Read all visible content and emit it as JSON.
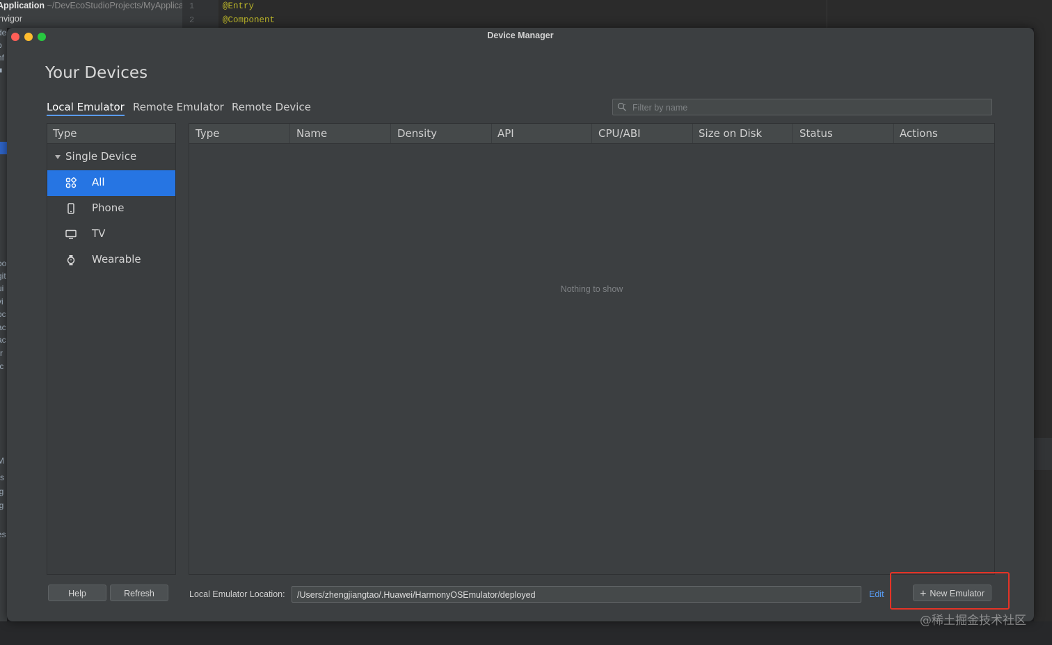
{
  "ide": {
    "project_name": "Application",
    "project_path": "~/DevEcoStudioProjects/MyApplicat",
    "tree_item": "hvigor",
    "line_numbers": [
      "1",
      "2"
    ],
    "code_lines": [
      "@Entry",
      "@Component"
    ],
    "left_strip_glyphs": [
      "de",
      "p",
      "nf",
      "■",
      "oo",
      "git",
      "ui",
      "vi",
      "oc",
      "ac",
      "ac",
      "rr",
      "tc",
      "M",
      "rs",
      "ig",
      "ig",
      "es"
    ]
  },
  "window": {
    "title": "Device Manager"
  },
  "page": {
    "title": "Your Devices"
  },
  "tabs": [
    "Local Emulator",
    "Remote Emulator",
    "Remote Device"
  ],
  "filter": {
    "placeholder": "Filter by name"
  },
  "type_panel": {
    "header": "Type",
    "group": "Single Device",
    "items": [
      {
        "label": "All",
        "icon": "grid-icon",
        "selected": true
      },
      {
        "label": "Phone",
        "icon": "phone-icon",
        "selected": false
      },
      {
        "label": "TV",
        "icon": "tv-icon",
        "selected": false
      },
      {
        "label": "Wearable",
        "icon": "watch-icon",
        "selected": false
      }
    ]
  },
  "table": {
    "columns": [
      "Type",
      "Name",
      "Density",
      "API",
      "CPU/ABI",
      "Size on Disk",
      "Status",
      "Actions"
    ],
    "empty_message": "Nothing to show"
  },
  "footer": {
    "help_label": "Help",
    "refresh_label": "Refresh",
    "location_label": "Local Emulator Location:",
    "location_value": "/Users/zhengjiangtao/.Huawei/HarmonyOSEmulator/deployed",
    "edit_label": "Edit",
    "new_emulator_label": "New Emulator"
  },
  "watermark": "@稀土掘金技术社区",
  "colors": {
    "accent": "#2675e3",
    "link": "#589df6",
    "highlight": "#e53326",
    "dialog_bg": "#3c3f41"
  }
}
